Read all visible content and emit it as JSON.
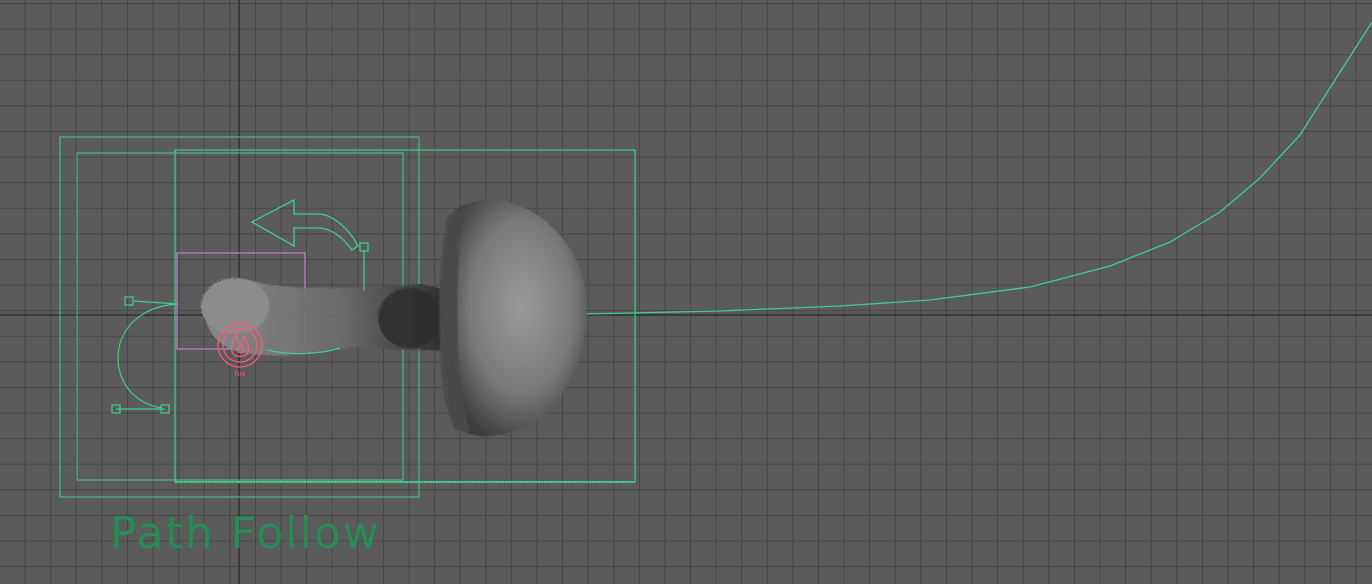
{
  "viewport": {
    "background_color": "#5b5b5b",
    "grid_color": "#474747",
    "gizmo_color": "#3fcf8e",
    "emitter_color": "#ff5a7a",
    "selection_color": "#d98ad8"
  },
  "labels": {
    "path_follow": "Path Follow",
    "fire_emitter": "Fire"
  },
  "icons": {
    "fire_emitter": "flame-icon",
    "direction": "arrow-left-icon"
  }
}
